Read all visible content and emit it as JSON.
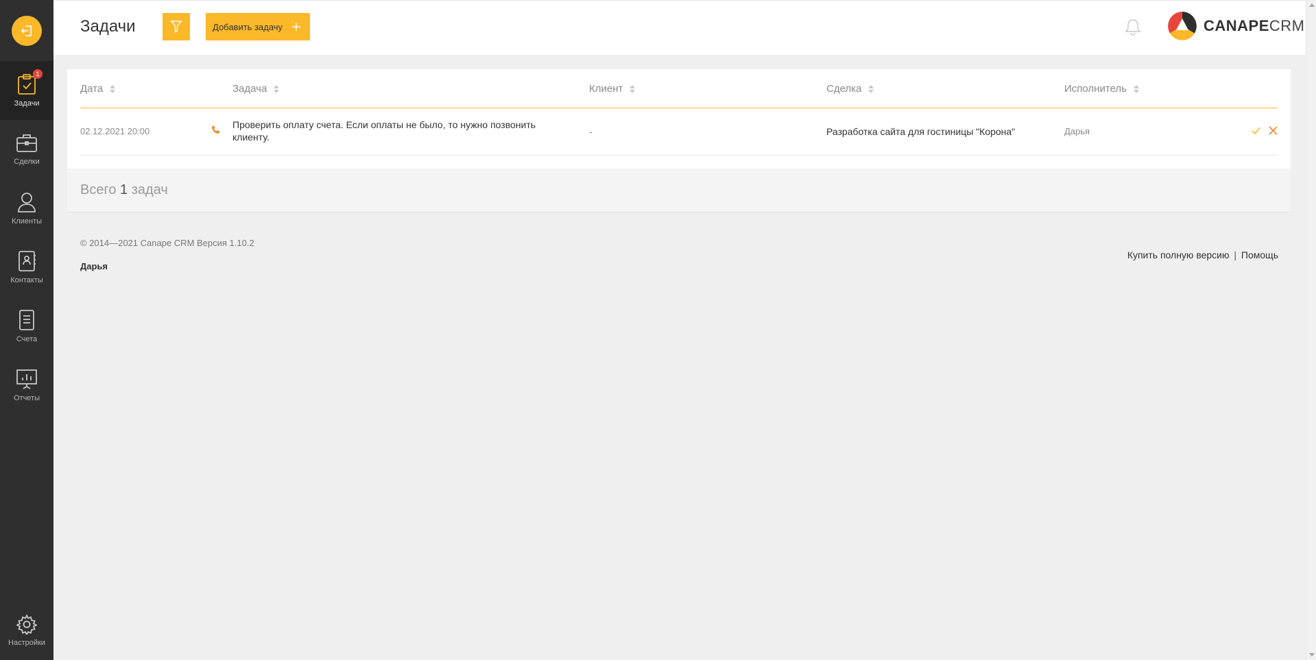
{
  "sidebar": {
    "items": [
      {
        "label": "Задачи",
        "icon": "tasks-icon",
        "badge": "1",
        "active": true
      },
      {
        "label": "Сделки",
        "icon": "briefcase-icon"
      },
      {
        "label": "Клиенты",
        "icon": "user-icon"
      },
      {
        "label": "Контакты",
        "icon": "contacts-book-icon"
      },
      {
        "label": "Счета",
        "icon": "invoice-icon"
      },
      {
        "label": "Отчеты",
        "icon": "reports-icon"
      }
    ],
    "settings_label": "Настройки"
  },
  "header": {
    "title": "Задачи",
    "add_button_label": "Добавить задачу",
    "brand_bold": "CANAPE",
    "brand_light": "CRM"
  },
  "table": {
    "columns": [
      "Дата",
      "Задача",
      "Клиент",
      "Сделка",
      "Исполнитель"
    ],
    "rows": [
      {
        "date": "02.12.2021 20:00",
        "type_icon": "phone-icon",
        "task": "Проверить оплату счета. Если оплаты не было, то нужно позвонить клиенту.",
        "client": "-",
        "deal": "Разработка сайта для гостиницы \"Корона\"",
        "executor": "Дарья"
      }
    ]
  },
  "summary": {
    "prefix": "Всего",
    "count": "1",
    "suffix": "задач"
  },
  "footer": {
    "copyright": "© 2014—2021 Canape CRM Версия 1.10.2",
    "user": "Дарья",
    "buy_link": "Купить полную версию",
    "separator": "|",
    "help_link": "Помощь"
  },
  "colors": {
    "accent": "#fbb829",
    "sidebar_bg": "#2f2f2f",
    "badge": "#e8463d"
  }
}
